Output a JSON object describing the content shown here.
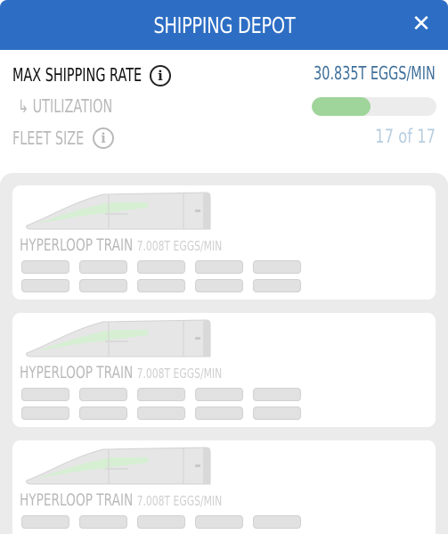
{
  "header": {
    "title": "SHIPPING DEPOT",
    "close_glyph": "✕",
    "color": "#2d6ec4"
  },
  "stats": {
    "max_rate_label": "MAX SHIPPING RATE",
    "max_rate_value": "30.835T EGGS/MIN",
    "utilization_label": "↳ UTILIZATION",
    "utilization_fraction": 0.47,
    "fleet_label": "FLEET SIZE",
    "fleet_value": "17 of 17",
    "info_glyph": "i"
  },
  "vehicles": [
    {
      "name": "HYPERLOOP TRAIN",
      "rate": "7.008T EGGS/MIN",
      "cars_per_row": 5
    },
    {
      "name": "HYPERLOOP TRAIN",
      "rate": "7.008T EGGS/MIN",
      "cars_per_row": 5
    },
    {
      "name": "HYPERLOOP TRAIN",
      "rate": "7.008T EGGS/MIN",
      "cars_per_row": 5
    }
  ],
  "colors": {
    "accent": "#2d6ec4",
    "utilization_fill": "#9fd59a",
    "rate_text": "#3f6f9a"
  }
}
